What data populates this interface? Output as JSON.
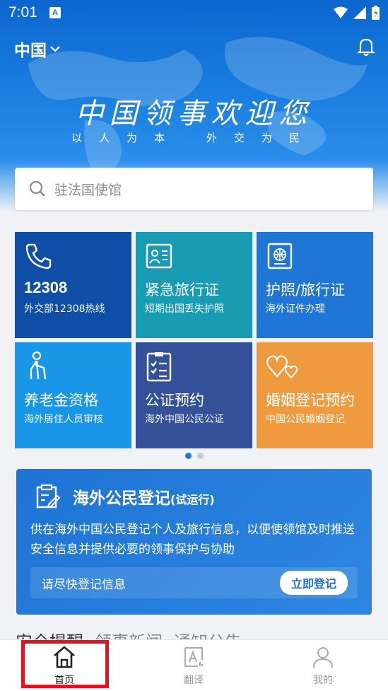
{
  "status": {
    "time": "7:01",
    "app_badge": "A"
  },
  "header": {
    "region": "中国",
    "title": "中国领事欢迎您",
    "subtitle_left": "以人为本",
    "subtitle_right": "外交为民"
  },
  "search": {
    "placeholder": "驻法国使馆"
  },
  "tiles": [
    {
      "title": "12308",
      "subtitle": "外交部12308热线",
      "color": "#0f4fa8",
      "icon": "phone-icon"
    },
    {
      "title": "紧急旅行证",
      "subtitle": "短期出国丢失护照",
      "color": "#1a9bb4",
      "icon": "id-card-icon"
    },
    {
      "title": "护照/旅行证",
      "subtitle": "海外证件办理",
      "color": "#1f76d6",
      "icon": "passport-icon"
    },
    {
      "title": "养老金资格",
      "subtitle": "海外居住人员审核",
      "color": "#1a96e8",
      "icon": "elderly-icon"
    },
    {
      "title": "公证预约",
      "subtitle": "海外中国公民公证",
      "color": "#34519a",
      "icon": "checklist-icon"
    },
    {
      "title": "婚姻登记预约",
      "subtitle": "中国公民婚姻登记",
      "color": "#ef9a3e",
      "icon": "hearts-icon"
    }
  ],
  "registration": {
    "title": "海外公民登记",
    "tag": "(试运行)",
    "description": "供在海外中国公民登记个人及旅行信息，以便使领馆及时推送安全信息并提供必要的领事保护与协助",
    "prompt": "请尽快登记信息",
    "button": "立即登记"
  },
  "news_tabs": [
    "安全提醒",
    "领事新闻",
    "通知公告"
  ],
  "tabbar": [
    {
      "label": "首页",
      "icon": "home-icon",
      "active": true
    },
    {
      "label": "翻译",
      "icon": "translate-icon",
      "active": false
    },
    {
      "label": "我的",
      "icon": "profile-icon",
      "active": false
    }
  ],
  "colors": {
    "primary": "#1f6fd1",
    "highlight": "#e8101c"
  }
}
